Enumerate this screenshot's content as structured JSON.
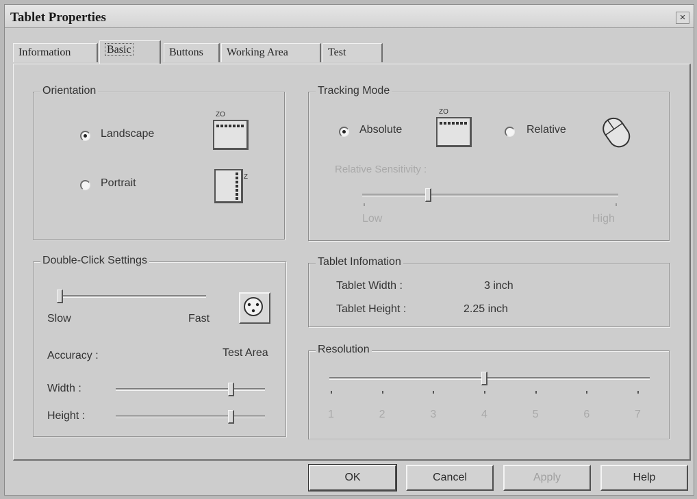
{
  "window": {
    "title": "Tablet Properties",
    "close_glyph": "×"
  },
  "tabs": [
    {
      "label": "Information"
    },
    {
      "label": "Basic",
      "active": true
    },
    {
      "label": "Buttons"
    },
    {
      "label": "Working Area"
    },
    {
      "label": "Test"
    }
  ],
  "orientation": {
    "title": "Orientation",
    "landscape": {
      "label": "Landscape",
      "selected": true
    },
    "portrait": {
      "label": "Portrait",
      "selected": false
    },
    "icon_tag": "ZO"
  },
  "tracking": {
    "title": "Tracking Mode",
    "absolute": {
      "label": "Absolute",
      "selected": true
    },
    "relative": {
      "label": "Relative",
      "selected": false
    },
    "sensitivity_label": "Relative Sensitivity :",
    "low_label": "Low",
    "high_label": "High",
    "sensitivity_value": 0.25
  },
  "double_click": {
    "title": "Double-Click Settings",
    "speed_value": 0.0,
    "slow_label": "Slow",
    "fast_label": "Fast",
    "test_area_label": "Test Area",
    "accuracy_label": "Accuracy :",
    "width_label": "Width :",
    "width_value": 0.78,
    "height_label": "Height :",
    "height_value": 0.78
  },
  "tablet_info": {
    "title": "Tablet Infomation",
    "width_label": "Tablet Width :",
    "width_value": "3 inch",
    "height_label": "Tablet Height :",
    "height_value": "2.25 inch"
  },
  "resolution": {
    "title": "Resolution",
    "ticks": [
      "1",
      "2",
      "3",
      "4",
      "5",
      "6",
      "7"
    ],
    "value": 4
  },
  "buttons": {
    "ok": "OK",
    "cancel": "Cancel",
    "apply": "Apply",
    "help": "Help"
  }
}
